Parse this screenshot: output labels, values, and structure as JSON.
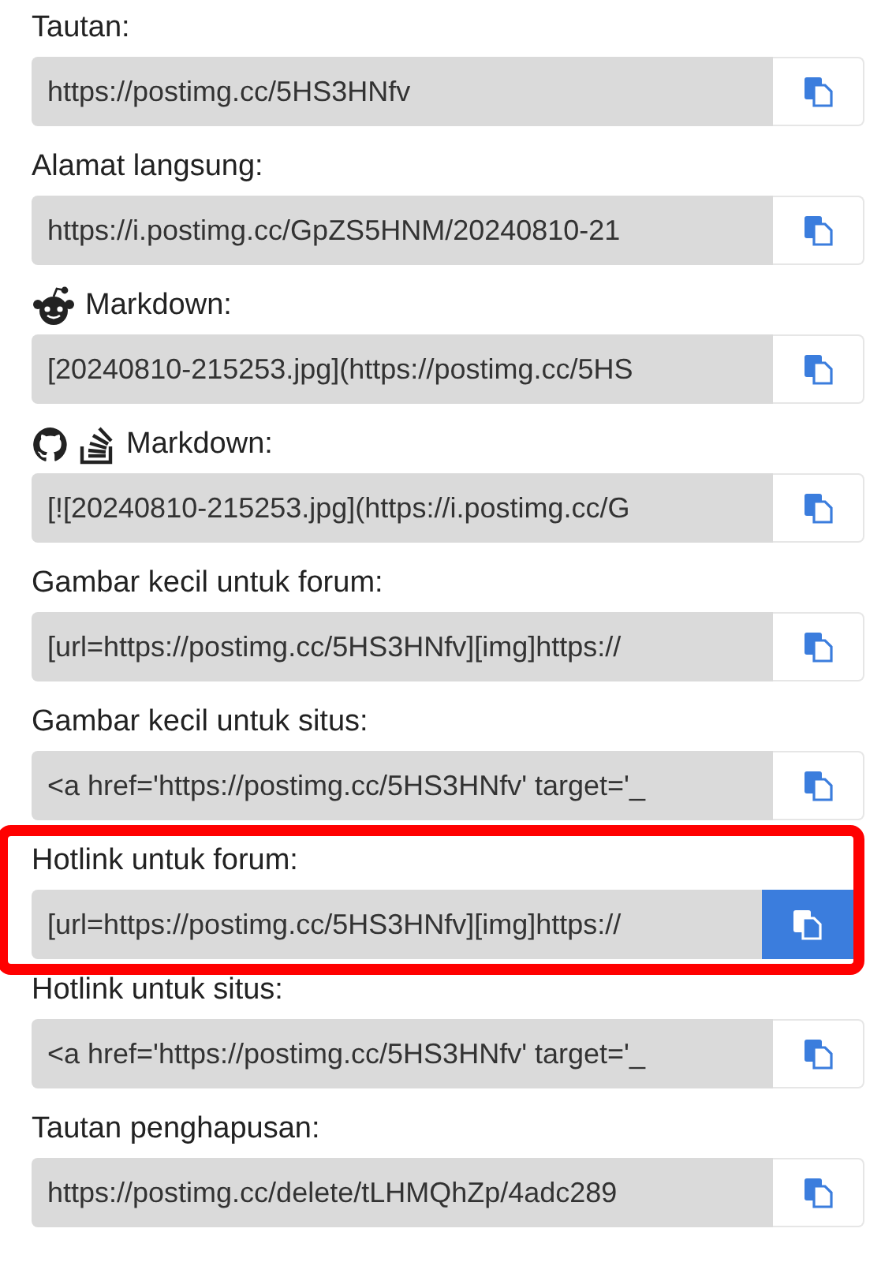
{
  "links": [
    {
      "label": "Tautan:",
      "value": "https://postimg.cc/5HS3HNfv",
      "highlighted": false,
      "copy_active": false
    },
    {
      "label": "Alamat langsung:",
      "value": "https://i.postimg.cc/GpZS5HNM/20240810-21",
      "highlighted": false,
      "copy_active": false
    },
    {
      "label": "Markdown:",
      "label_icons": [
        {
          "kind": "reddit"
        }
      ],
      "value": "[20240810-215253.jpg](https://postimg.cc/5HS",
      "highlighted": false,
      "copy_active": false
    },
    {
      "label": "Markdown:",
      "label_icons": [
        {
          "kind": "github"
        },
        {
          "kind": "stackoverflow"
        }
      ],
      "value": "[![20240810-215253.jpg](https://i.postimg.cc/G",
      "highlighted": false,
      "copy_active": false
    },
    {
      "label": "Gambar kecil untuk forum:",
      "value": "[url=https://postimg.cc/5HS3HNfv][img]https://",
      "highlighted": false,
      "copy_active": false
    },
    {
      "label": "Gambar kecil untuk situs:",
      "value": "<a href='https://postimg.cc/5HS3HNfv' target='_",
      "highlighted": false,
      "copy_active": false
    },
    {
      "label": "Hotlink untuk forum:",
      "value": "[url=https://postimg.cc/5HS3HNfv][img]https://",
      "highlighted": true,
      "copy_active": true
    },
    {
      "label": "Hotlink untuk situs:",
      "value": "<a href='https://postimg.cc/5HS3HNfv' target='_",
      "highlighted": false,
      "copy_active": false
    },
    {
      "label": "Tautan penghapusan:",
      "value": "https://postimg.cc/delete/tLHMQhZp/4adc289",
      "highlighted": false,
      "copy_active": false
    }
  ]
}
